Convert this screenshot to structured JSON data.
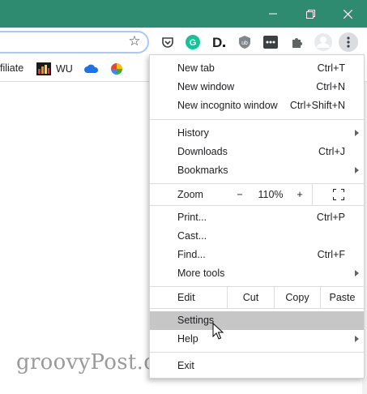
{
  "colors": {
    "titlebar": "#2e8b6f",
    "highlight": "#c6c6c6"
  },
  "window_controls": {
    "minimize_icon": "minimize-icon",
    "restore_icon": "restore-icon",
    "close_icon": "close-icon"
  },
  "toolbar": {
    "star_icon": "star-icon",
    "extensions_icon": "puzzle-icon",
    "menu_icon": "kebab-menu-icon"
  },
  "bookmarks": [
    {
      "label": "filiate"
    },
    {
      "label": "WU"
    },
    {
      "label": ""
    },
    {
      "label": ""
    }
  ],
  "menu": {
    "new_tab": {
      "label": "New tab",
      "shortcut": "Ctrl+T"
    },
    "new_window": {
      "label": "New window",
      "shortcut": "Ctrl+N"
    },
    "new_incognito": {
      "label": "New incognito window",
      "shortcut": "Ctrl+Shift+N"
    },
    "history": {
      "label": "History"
    },
    "downloads": {
      "label": "Downloads",
      "shortcut": "Ctrl+J"
    },
    "bookmarks": {
      "label": "Bookmarks"
    },
    "zoom": {
      "label": "Zoom",
      "minus": "−",
      "value": "110%",
      "plus": "+"
    },
    "print": {
      "label": "Print...",
      "shortcut": "Ctrl+P"
    },
    "cast": {
      "label": "Cast..."
    },
    "find": {
      "label": "Find...",
      "shortcut": "Ctrl+F"
    },
    "more_tools": {
      "label": "More tools"
    },
    "edit": {
      "label": "Edit",
      "cut": "Cut",
      "copy": "Copy",
      "paste": "Paste"
    },
    "settings": {
      "label": "Settings"
    },
    "help": {
      "label": "Help"
    },
    "exit": {
      "label": "Exit"
    }
  },
  "watermark": "groovyPost.com"
}
